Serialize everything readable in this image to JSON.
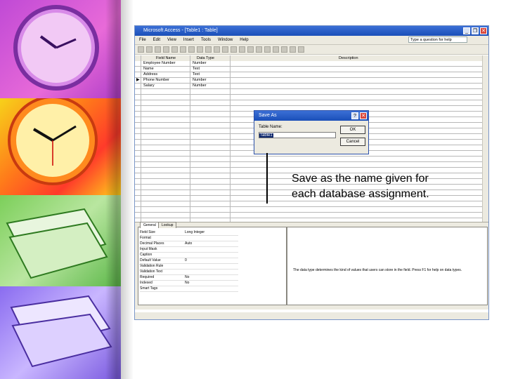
{
  "window": {
    "title": "Microsoft Access - [Table1 : Table]",
    "menu": [
      "File",
      "Edit",
      "View",
      "Insert",
      "Tools",
      "Window",
      "Help"
    ],
    "ask_placeholder": "Type a question for help"
  },
  "grid": {
    "headers": [
      "Field Name",
      "Data Type",
      "Description"
    ],
    "rows": [
      {
        "field": "Employee Number",
        "type": "Number"
      },
      {
        "field": "Name",
        "type": "Text"
      },
      {
        "field": "Address",
        "type": "Text"
      },
      {
        "field": "Phone Number",
        "type": "Number"
      },
      {
        "field": "Salary",
        "type": "Number"
      }
    ]
  },
  "properties": {
    "tabs": [
      "General",
      "Lookup"
    ],
    "rows": [
      {
        "label": "Field Size",
        "value": "Long Integer"
      },
      {
        "label": "Format",
        "value": ""
      },
      {
        "label": "Decimal Places",
        "value": "Auto"
      },
      {
        "label": "Input Mask",
        "value": ""
      },
      {
        "label": "Caption",
        "value": ""
      },
      {
        "label": "Default Value",
        "value": "0"
      },
      {
        "label": "Validation Rule",
        "value": ""
      },
      {
        "label": "Validation Text",
        "value": ""
      },
      {
        "label": "Required",
        "value": "No"
      },
      {
        "label": "Indexed",
        "value": "No"
      },
      {
        "label": "Smart Tags",
        "value": ""
      }
    ],
    "help_text": "The data type determines the kind of values that users can store in the field. Press F1 for help on data types."
  },
  "dialog": {
    "title": "Save As",
    "label": "Table Name:",
    "value": "Table1",
    "ok": "OK",
    "cancel": "Cancel"
  },
  "callout": {
    "text": "Save as the name given for each database assignment."
  }
}
